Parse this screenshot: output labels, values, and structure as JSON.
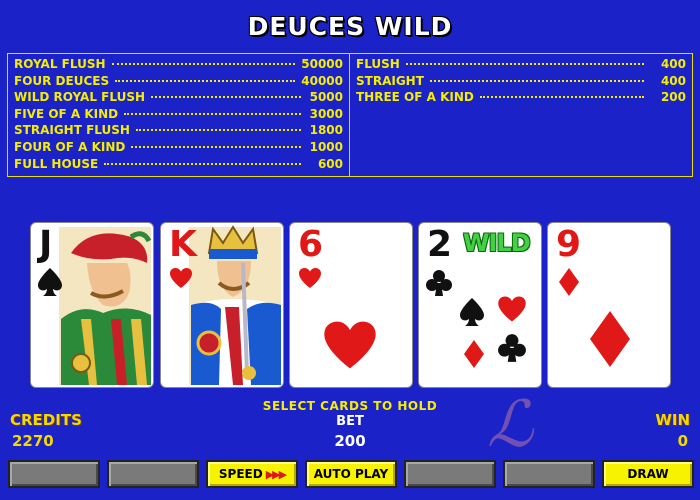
{
  "game": {
    "title": "DEUCES WILD"
  },
  "paytable": {
    "left": [
      {
        "hand": "ROYAL FLUSH",
        "pays": "50000"
      },
      {
        "hand": "FOUR DEUCES",
        "pays": "40000"
      },
      {
        "hand": "WILD ROYAL FLUSH",
        "pays": "5000"
      },
      {
        "hand": "FIVE OF A KIND",
        "pays": "3000"
      },
      {
        "hand": "STRAIGHT FLUSH",
        "pays": "1800"
      },
      {
        "hand": "FOUR OF A KIND",
        "pays": "1000"
      },
      {
        "hand": "FULL HOUSE",
        "pays": "600"
      }
    ],
    "right": [
      {
        "hand": "FLUSH",
        "pays": "400"
      },
      {
        "hand": "STRAIGHT",
        "pays": "400"
      },
      {
        "hand": "THREE OF A KIND",
        "pays": "200"
      }
    ]
  },
  "cards": [
    {
      "rank": "J",
      "suit": "spade",
      "color": "black"
    },
    {
      "rank": "K",
      "suit": "heart",
      "color": "red"
    },
    {
      "rank": "6",
      "suit": "heart",
      "color": "red"
    },
    {
      "rank": "2",
      "suit": "club",
      "color": "black",
      "badge": "WILD"
    },
    {
      "rank": "9",
      "suit": "diamond",
      "color": "red"
    }
  ],
  "status": {
    "message": "SELECT CARDS TO HOLD",
    "bet_label": "BET",
    "bet_value": "200",
    "credits_label": "CREDITS",
    "credits_value": "2270",
    "win_label": "WIN",
    "win_value": "0"
  },
  "buttons": {
    "speed": "SPEED",
    "speed_arrows": "▶▶▶",
    "auto_play": "AUTO PLAY",
    "draw": "DRAW"
  },
  "colors": {
    "background": "#1a22c8",
    "paytable_text": "#f5ee00",
    "button_lit": "#f7f200",
    "button_off": "#7a7a7a"
  }
}
